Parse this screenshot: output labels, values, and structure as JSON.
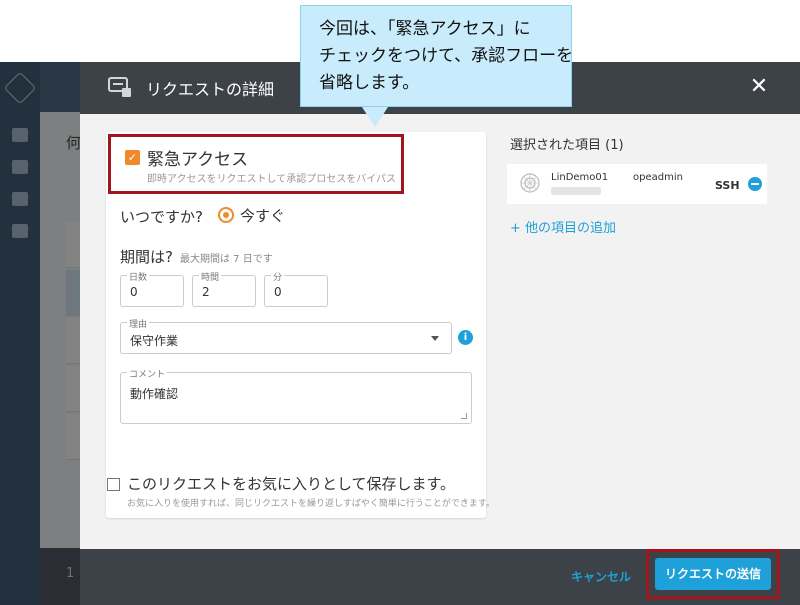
{
  "background": {
    "title_fragment": "何",
    "footer_fragment": "1"
  },
  "modal": {
    "title": "リクエストの詳細",
    "close_label": "✕"
  },
  "emergency": {
    "label": "緊急アクセス",
    "description": "即時アクセスをリクエストして承認プロセスをバイパス",
    "checked": true
  },
  "when": {
    "label": "いつですか?",
    "option": "今すぐ"
  },
  "period": {
    "label": "期間は?",
    "hint": "最大期間は 7 日です",
    "days_label": "日数",
    "days_value": "0",
    "hours_label": "時間",
    "hours_value": "2",
    "minutes_label": "分",
    "minutes_value": "0"
  },
  "reason": {
    "label": "理由",
    "value": "保守作業"
  },
  "comment": {
    "label": "コメント",
    "value": "動作確認"
  },
  "favorite": {
    "label": "このリクエストをお気に入りとして保存します。",
    "description": "お気に入りを使用すれば、同じリクエストを繰り返しすばやく簡単に行うことができます。"
  },
  "selected": {
    "title": "選択された項目 (1)",
    "items": [
      {
        "name": "LinDemo01",
        "user": "opeadmin",
        "protocol": "SSH"
      }
    ],
    "add_label": "+ 他の項目の追加"
  },
  "footer": {
    "cancel_label": "キャンセル",
    "submit_label": "リクエストの送信"
  },
  "callout": {
    "text": "今回は、「緊急アクセス」に\nチェックをつけて、承認フローを\n省略します。"
  },
  "colors": {
    "accent": "#1ea0d8",
    "orange": "#f0892a",
    "highlight_border": "#a1161c",
    "modal_header": "#3d4248",
    "callout_bg": "#c8ecfb"
  }
}
